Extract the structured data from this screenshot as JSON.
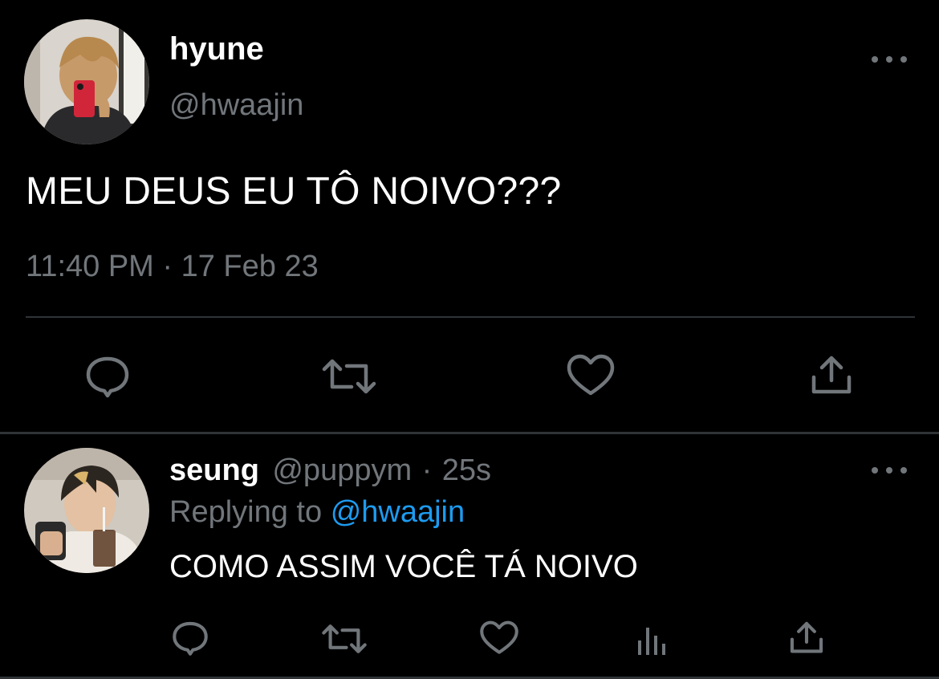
{
  "main_tweet": {
    "author_name": "hyune",
    "author_handle": "@hwaajin",
    "text": "MEU DEUS EU TÔ NOIVO???",
    "timestamp": "11:40 PM · 17 Feb 23",
    "actions": [
      "reply-icon",
      "retweet-icon",
      "like-icon",
      "share-icon"
    ]
  },
  "reply": {
    "author_name": "seung",
    "author_handle": "@puppym",
    "separator": "·",
    "time_ago": "25s",
    "replying_prefix": "Replying to",
    "replying_to": "@hwaajin",
    "text": "COMO ASSIM VOCÊ TÁ NOIVO",
    "actions": [
      "reply-icon",
      "retweet-icon",
      "like-icon",
      "analytics-icon",
      "share-icon"
    ]
  },
  "colors": {
    "background": "#000000",
    "primary_text": "#ffffff",
    "secondary_text": "#71767b",
    "accent": "#1d9bf0",
    "divider": "#2f3336"
  }
}
